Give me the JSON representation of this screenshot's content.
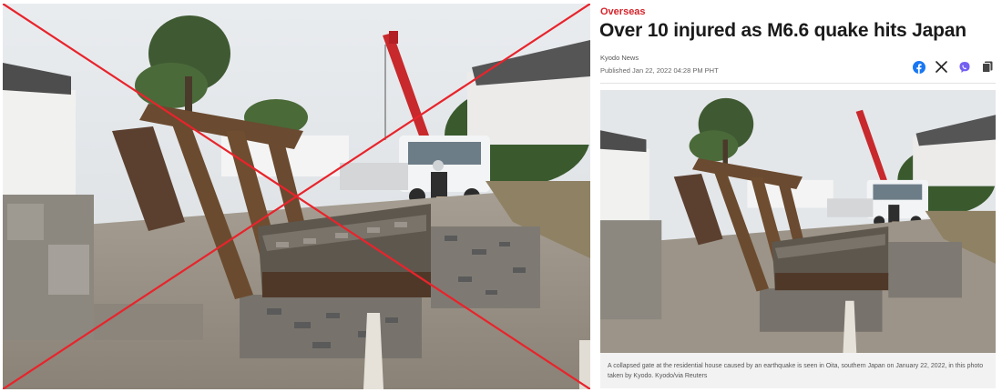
{
  "article": {
    "section": "Overseas",
    "headline": "Over 10 injured as M6.6 quake hits Japan",
    "byline": "Kyodo News",
    "published": "Published Jan 22, 2022 04:28 PM PHT",
    "caption": "A collapsed gate at the residential house caused by an earthquake is seen in Oita, southern Japan on January 22, 2022, in this photo taken by Kyodo. Kyodo/via Reuters"
  },
  "share_icons": [
    "facebook-icon",
    "x-icon",
    "viber-icon",
    "copy-icon"
  ],
  "colors": {
    "section_red": "#d4232a",
    "strike_red": "#e8242c",
    "facebook_blue": "#1877f2",
    "viber_purple": "#7360f2"
  }
}
